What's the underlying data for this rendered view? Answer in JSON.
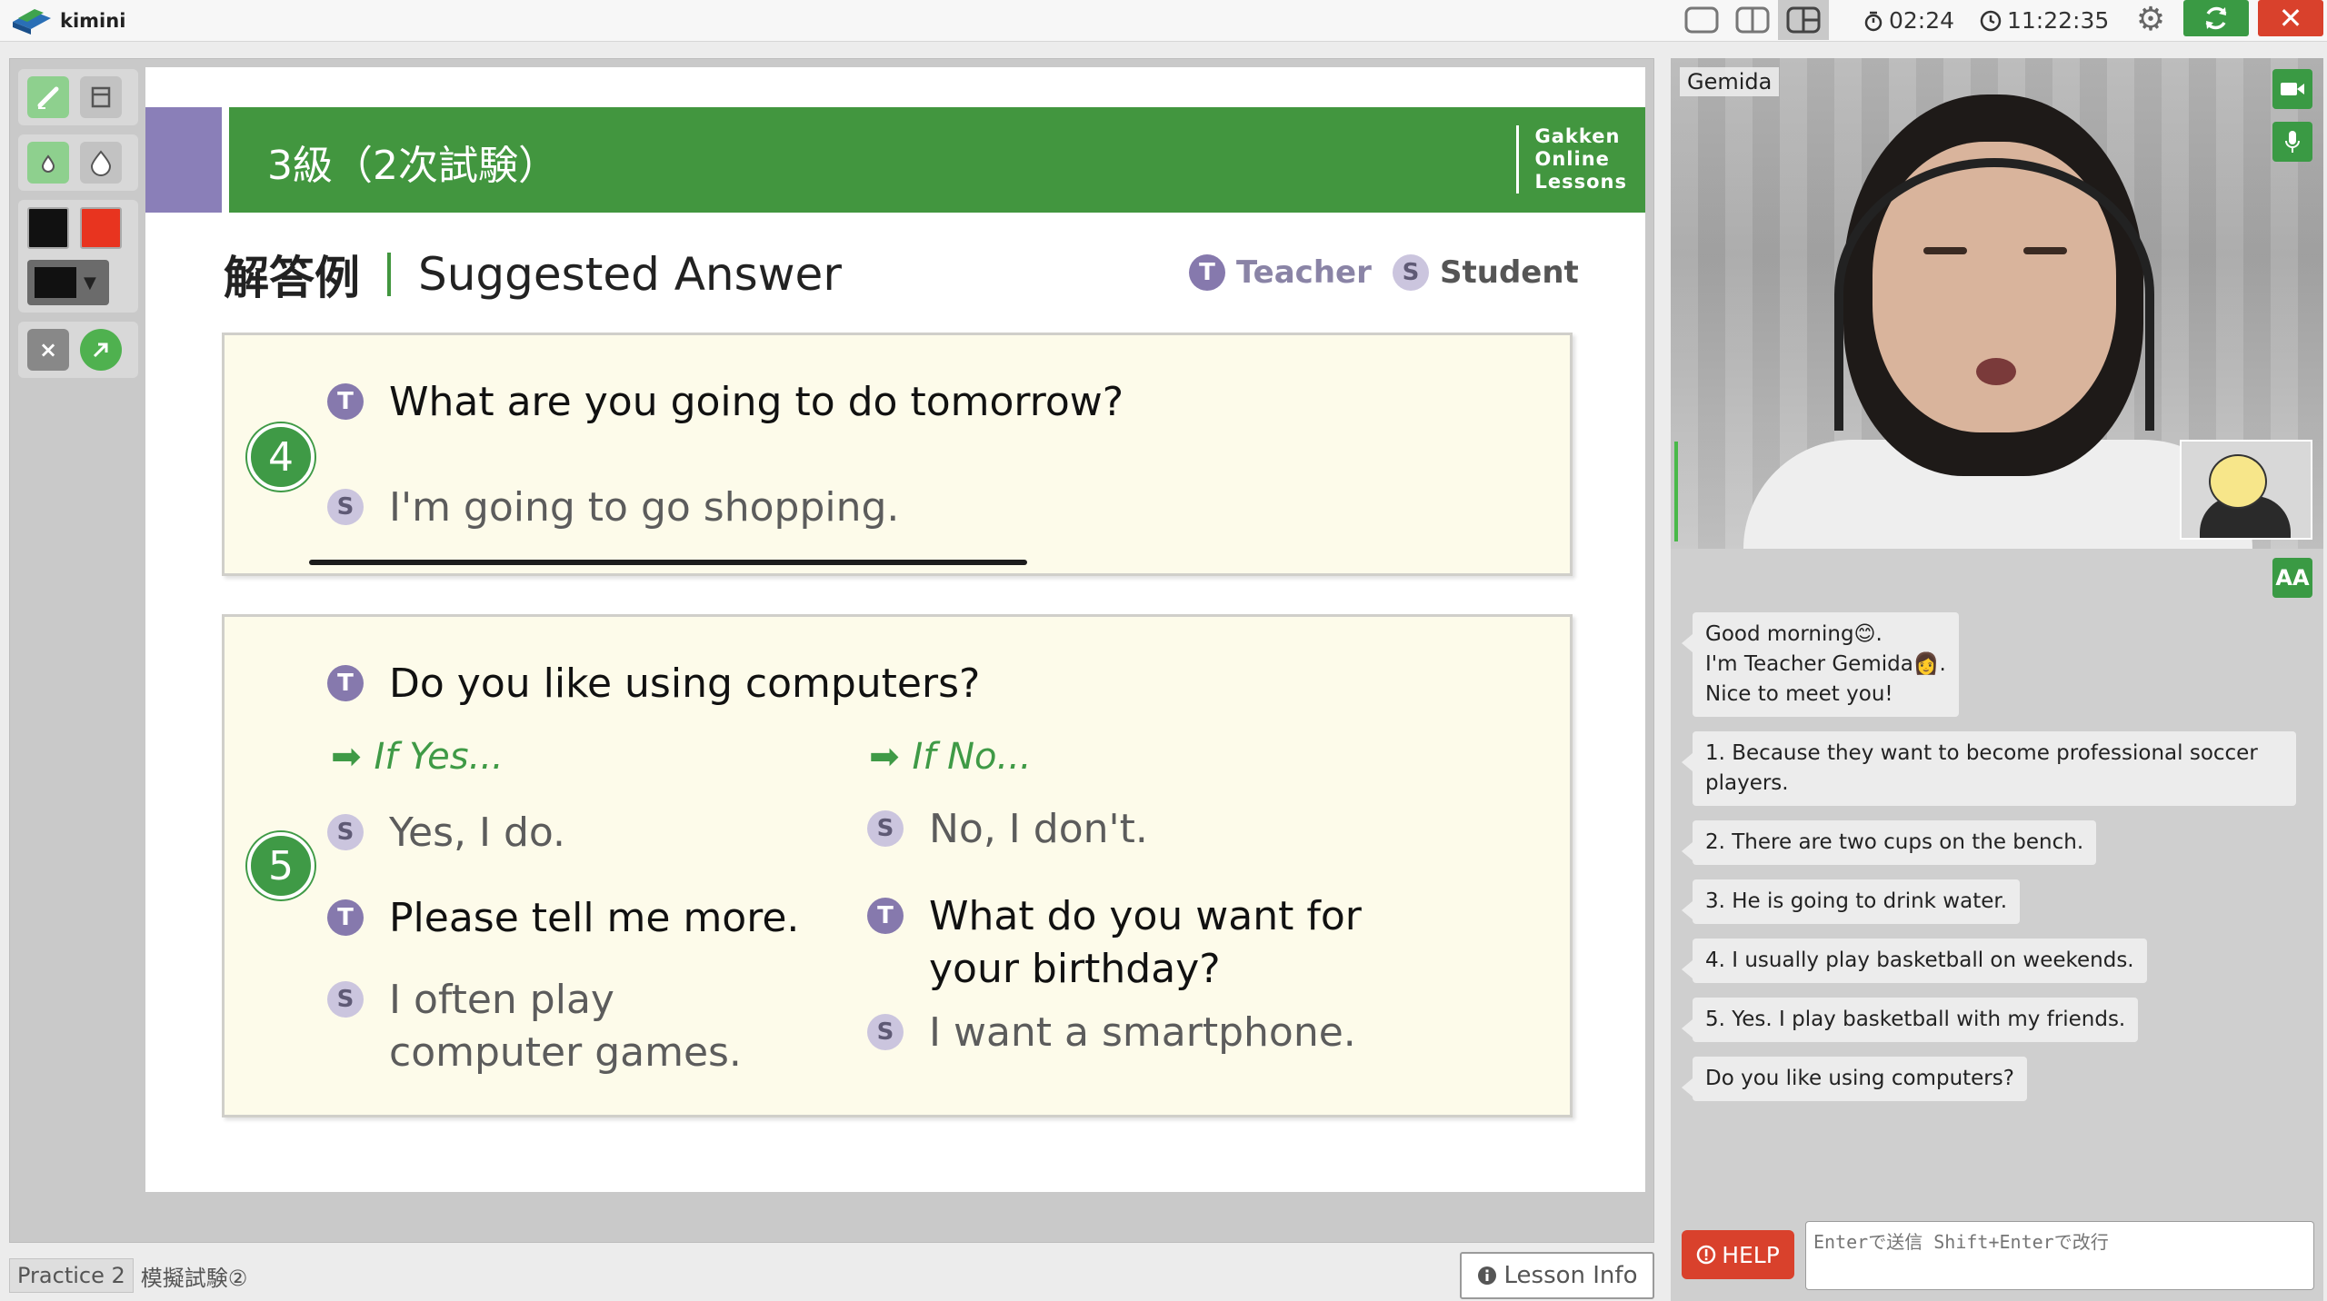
{
  "app": {
    "name": "kimini"
  },
  "topbar": {
    "timer_elapsed": "02:24",
    "clock": "11:22:35"
  },
  "slide": {
    "banner_title": "3級（2次試験）",
    "brand_lines": [
      "Gakken",
      "Online",
      "Lessons"
    ],
    "heading_jp": "解答例",
    "heading_en": "Suggested Answer",
    "legend": {
      "teacher_badge": "T",
      "teacher_label": "Teacher",
      "student_badge": "S",
      "student_label": "Student"
    },
    "q4": {
      "number": "4",
      "teacher_badge": "T",
      "teacher_text": "What are you going to do tomorrow?",
      "student_badge": "S",
      "student_text": "I'm going to go shopping."
    },
    "q5": {
      "number": "5",
      "teacher_badge": "T",
      "teacher_text": "Do you like using computers?",
      "if_yes": "If Yes...",
      "if_no": "If No...",
      "yes_student": "Yes, I do.",
      "yes_teacher": "Please tell me more.",
      "yes_student2": "I often play computer games.",
      "no_student": "No, I don't.",
      "no_teacher": "What do you want for your birthday?",
      "no_student2": "I want a smartphone."
    }
  },
  "bottom": {
    "practice_tag": "Practice 2",
    "practice_name": "模擬試験②",
    "lesson_info": "Lesson Info"
  },
  "video": {
    "teacher_name": "Gemida",
    "font_btn": "AA"
  },
  "chat": {
    "messages": [
      "Good morning😊.\nI'm Teacher Gemida👩.\nNice to meet you!",
      "1. Because they want to become professional soccer players.",
      "2. There are two cups on the bench.",
      "3. He is going to drink water.",
      "4. I usually play basketball on weekends.",
      "5. Yes. I play basketball with my friends.",
      "Do you like using computers?"
    ],
    "help_label": "HELP",
    "input_placeholder": "Enterで送信 Shift+Enterで改行"
  },
  "colors": {
    "brand_green": "#42963f",
    "accent_purple": "#8a7fb8",
    "danger_red": "#d9412c"
  },
  "icons": [
    "pen-icon",
    "eraser-icon",
    "drop-small-icon",
    "drop-large-icon",
    "clear-icon",
    "pointer-icon",
    "timer-icon",
    "clock-icon",
    "gear-icon",
    "refresh-icon",
    "close-icon",
    "camera-icon",
    "mic-icon",
    "info-icon",
    "help-icon"
  ]
}
